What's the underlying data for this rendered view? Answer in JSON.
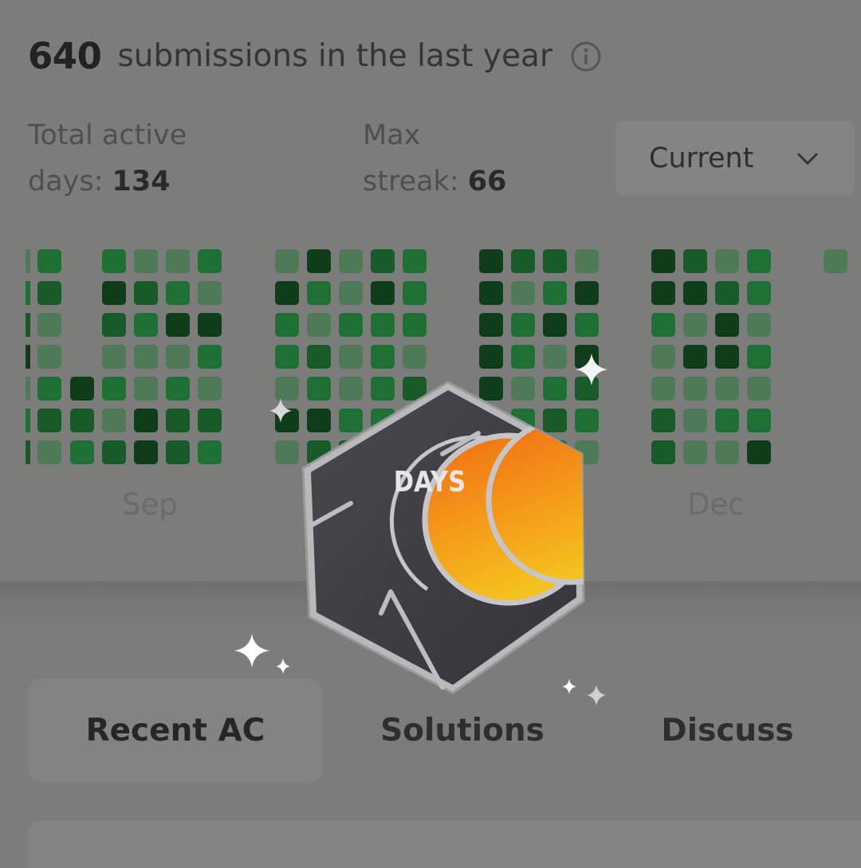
{
  "header": {
    "count": "640",
    "text": "submissions in the last year"
  },
  "stats": {
    "active_label_1": "Total active",
    "active_label_2": "days:",
    "active_value": "134",
    "streak_label_1": "Max",
    "streak_label_2": "streak:",
    "streak_value": "66"
  },
  "period_select": {
    "selected": "Current"
  },
  "calendar": {
    "months": [
      "Sep",
      "Dec"
    ]
  },
  "badge": {
    "label": "DAYS"
  },
  "tabs": [
    {
      "label": "Recent AC",
      "selected": true
    },
    {
      "label": "Solutions",
      "selected": false
    },
    {
      "label": "Discuss",
      "selected": false
    }
  ],
  "colors": {
    "level_1": "#4e7a57",
    "level_2": "#1f7034",
    "level_3": "#185a28",
    "level_4": "#0f3d1a",
    "badge_orange": "#f08a14",
    "badge_dark": "#3d3d42"
  }
}
